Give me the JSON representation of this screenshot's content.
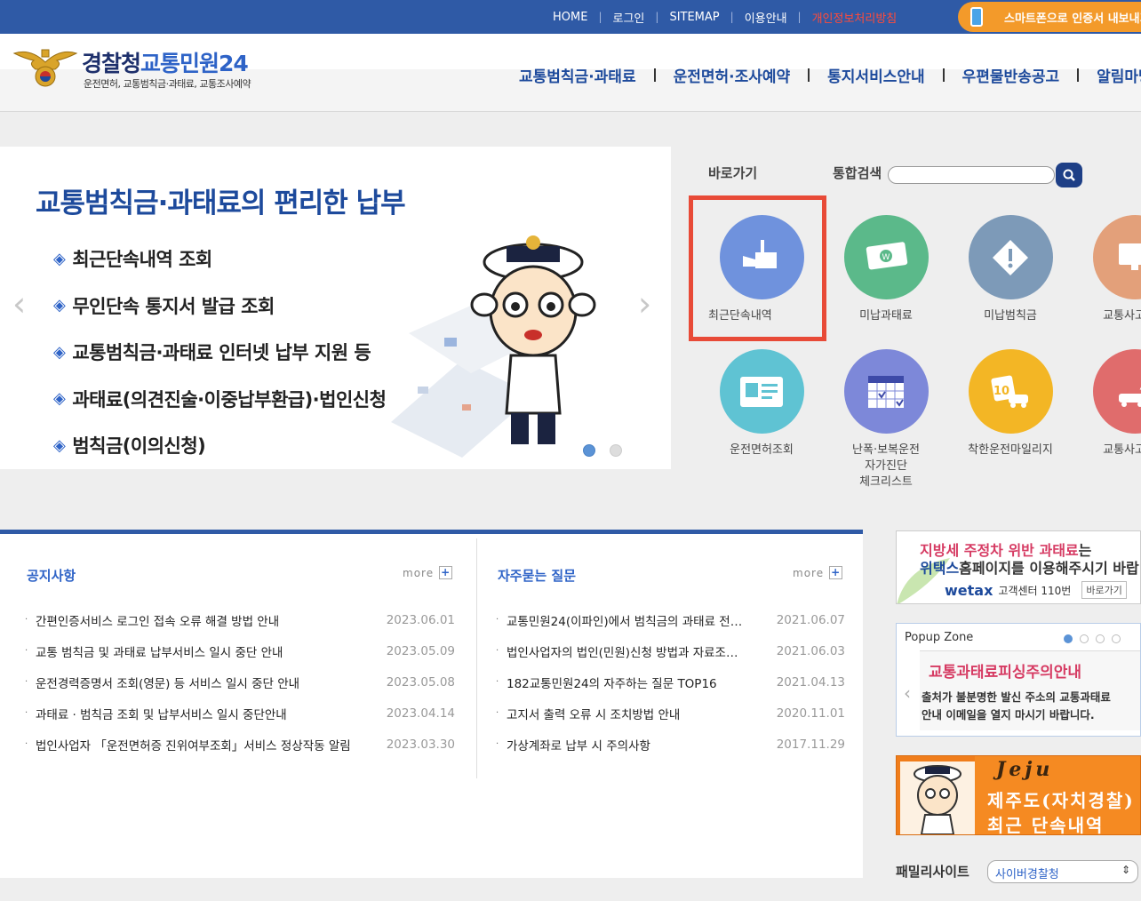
{
  "util_links": {
    "home": "HOME",
    "login": "로그인",
    "sitemap": "SITEMAP",
    "guide": "이용안내",
    "privacy": "개인정보처리방침",
    "smart": "스마트폰으로 인증서 내보내기"
  },
  "header": {
    "logo_main": "경찰청",
    "logo_blue": "교통민원24",
    "logo_sub": "운전면허, 교통범칙금·과태료, 교통조사예약"
  },
  "gnb": [
    "교통범칙금·과태료",
    "운전면허·조사예약",
    "통지서비스안내",
    "우편물반송공고",
    "알림마당"
  ],
  "banner": {
    "title": "교통범칙금·과태료의 편리한 납부",
    "items": [
      "최근단속내역 조회",
      "무인단속 통지서 발급 조회",
      "교통범칙금·과태료 인터넷 납부 지원 등",
      "과태료(의견진술·이중납부환급)·법인신청",
      "범칙금(이의신청)"
    ]
  },
  "quick": {
    "label": "바로가기",
    "search_label": "통합검색",
    "items": [
      {
        "label": "최근단속내역",
        "color": "#6f92dd"
      },
      {
        "label": "미납과태료",
        "color": "#5bb98a"
      },
      {
        "label": "미납범칙금",
        "color": "#7d9ab8"
      },
      {
        "label": "교통사고조사",
        "color": "#e3a07a"
      },
      {
        "label": "운전면허조회",
        "color": "#5fc3d3"
      },
      {
        "label": "난폭·보복운전\n자가진단\n체크리스트",
        "color": "#7d88d9"
      },
      {
        "label": "착한운전마일리지",
        "color": "#f3b625"
      },
      {
        "label": "교통사고확인",
        "color": "#e06c6c"
      }
    ]
  },
  "notice": {
    "title": "공지사항",
    "more": "more",
    "items": [
      {
        "title": "간편인증서비스 로그인 접속 오류 해결 방법 안내",
        "date": "2023.06.01"
      },
      {
        "title": "교통 범칙금 및 과태료 납부서비스 일시 중단 안내",
        "date": "2023.05.09"
      },
      {
        "title": "운전경력증명서 조회(영문) 등 서비스 일시 중단 안내",
        "date": "2023.05.08"
      },
      {
        "title": "과태료 · 범칙금 조회 및 납부서비스 일시 중단안내",
        "date": "2023.04.14"
      },
      {
        "title": "법인사업자 「운전면허증 진위여부조회」서비스 정상작동 알림",
        "date": "2023.03.30"
      }
    ]
  },
  "faq": {
    "title": "자주묻는 질문",
    "more": "more",
    "items": [
      {
        "title": "교통민원24(이파인)에서 범칙금의 과태료 전…",
        "date": "2021.06.07"
      },
      {
        "title": "법인사업자의 법인(민원)신청 방법과 자료조…",
        "date": "2021.06.03"
      },
      {
        "title": "182교통민원24의 자주하는 질문 TOP16",
        "date": "2021.04.13"
      },
      {
        "title": "고지서 출력 오류 시 조치방법 안내",
        "date": "2020.11.01"
      },
      {
        "title": "가상계좌로 납부 시 주의사항",
        "date": "2017.11.29"
      }
    ]
  },
  "ad_wetax": {
    "l1_red": "지방세 주정차 위반 과태료",
    "l1_rest": "는",
    "l2_blue": "위택스",
    "l2_rest": "홈페이지를 이용해주시기 바랍니다",
    "logo": "wetax",
    "center": "고객센터 110번",
    "go": "바로가기"
  },
  "popup": {
    "title": "Popup Zone",
    "heading": "교통과태료피싱주의안내",
    "line1": "출처가 불분명한 발신 주소의 교통과태료",
    "line2": "안내 이메일을 열지 마시기 바랍니다."
  },
  "jeju": {
    "logo": "Jeju",
    "line1": "제주도(자치경찰)",
    "line2": "최근 단속내역"
  },
  "family": {
    "label": "패밀리사이트",
    "selected": "사이버경찰청"
  }
}
